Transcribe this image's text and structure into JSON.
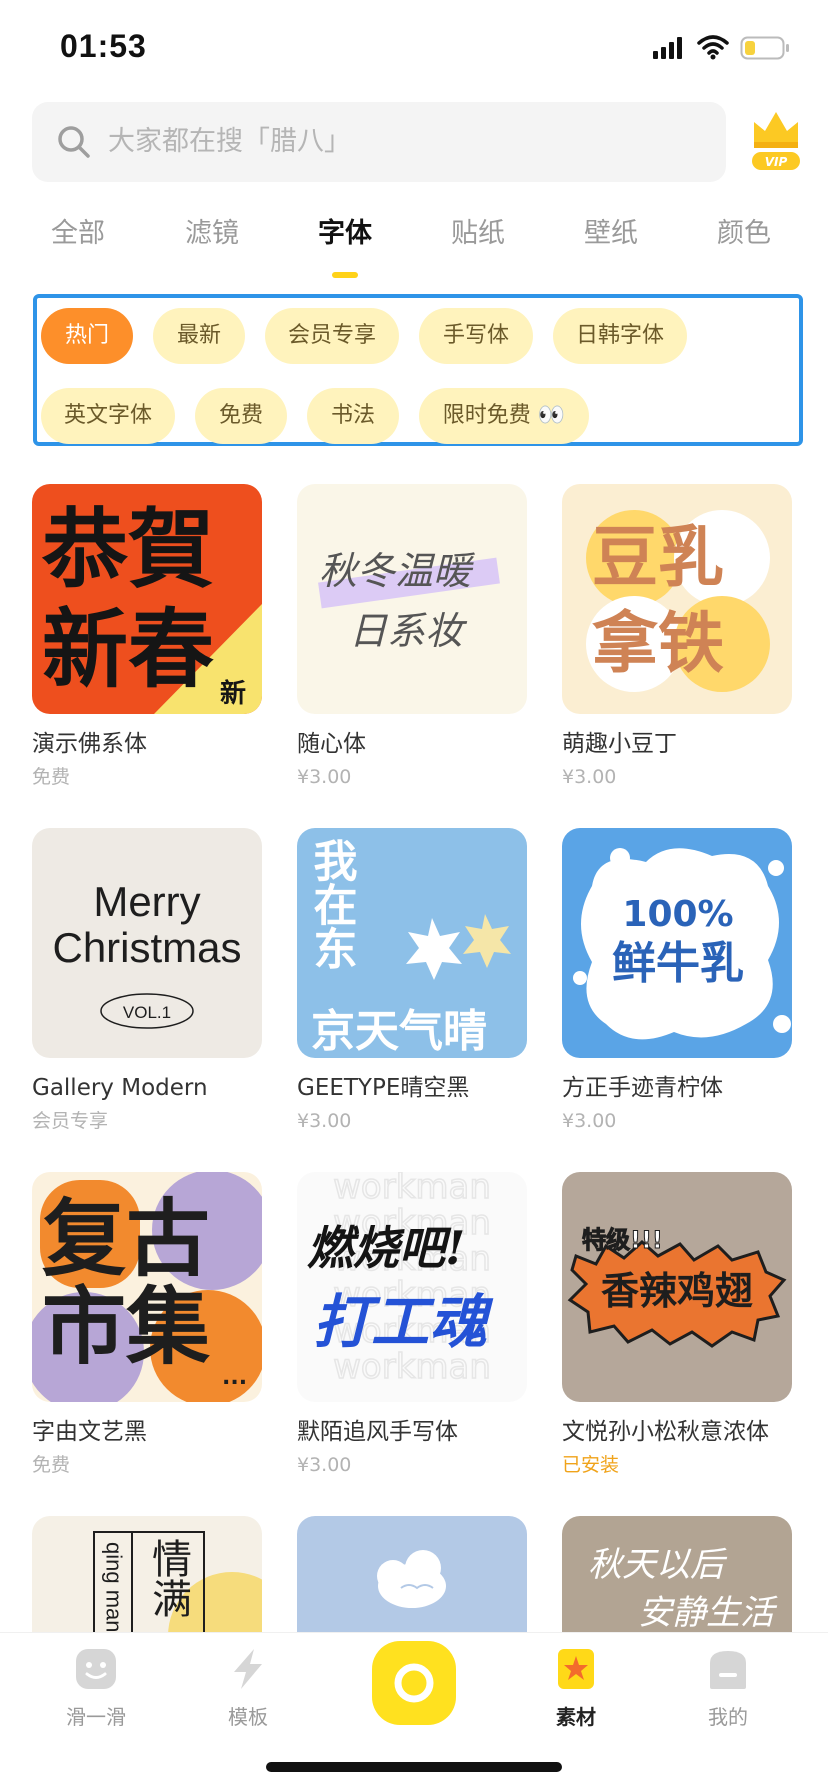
{
  "status_bar": {
    "time": "01:53"
  },
  "search": {
    "placeholder": "大家都在搜「腊八」",
    "vip_label": "VIP"
  },
  "tabs": [
    {
      "label": "全部"
    },
    {
      "label": "滤镜"
    },
    {
      "label": "字体",
      "active": true
    },
    {
      "label": "贴纸"
    },
    {
      "label": "壁纸"
    },
    {
      "label": "颜色"
    }
  ],
  "filters": [
    {
      "label": "热门",
      "active": true
    },
    {
      "label": "最新"
    },
    {
      "label": "会员专享"
    },
    {
      "label": "手写体"
    },
    {
      "label": "日韩字体"
    },
    {
      "label": "英文字体"
    },
    {
      "label": "免费"
    },
    {
      "label": "书法"
    },
    {
      "label": "限时免费 👀"
    }
  ],
  "fonts": [
    {
      "name": "演示佛系体",
      "price": "免费",
      "art": {
        "line1": "恭賀",
        "line2": "新春",
        "corner": "新"
      }
    },
    {
      "name": "随心体",
      "price": "¥3.00",
      "art": {
        "line1": "秋冬温暖",
        "line2": "日系妆"
      }
    },
    {
      "name": "萌趣小豆丁",
      "price": "¥3.00",
      "art": {
        "line1": "豆乳",
        "line2": "拿铁"
      }
    },
    {
      "name": "Gallery Modern",
      "price": "会员专享",
      "art": {
        "line1": "Merry",
        "line2": "Christmas",
        "vol": "VOL.1"
      }
    },
    {
      "name": "GEETYPE晴空黑",
      "price": "¥3.00",
      "art": {
        "col1": "我在东",
        "line": "京天气晴"
      }
    },
    {
      "name": "方正手迹青柠体",
      "price": "¥3.00",
      "art": {
        "line1": "100%",
        "line2": "鲜牛乳"
      }
    },
    {
      "name": "字由文艺黑",
      "price": "免费",
      "art": {
        "line1": "复古",
        "line2": "市集",
        "dots": "..."
      }
    },
    {
      "name": "默陌追风手写体",
      "price": "¥3.00",
      "art": {
        "bg_word": "workman",
        "line1": "燃烧吧!",
        "line2": "打工魂"
      }
    },
    {
      "name": "文悦孙小松秋意浓体",
      "price": "已安装",
      "art": {
        "tag": "特级!!!",
        "line": "香辣鸡翅"
      }
    },
    {
      "art": {
        "latin": "qing man",
        "line": "情满"
      }
    },
    {
      "art": {}
    },
    {
      "art": {
        "line1": "秋天以后",
        "line2": "安静生活"
      }
    }
  ],
  "bottom_nav": [
    {
      "label": "滑一滑"
    },
    {
      "label": "模板"
    },
    {
      "label": "素材",
      "active": true
    },
    {
      "label": "我的"
    }
  ],
  "colors": {
    "accent_yellow": "#ffe11f",
    "active_chip": "#fd8f2a",
    "chip_bg": "#fff3bd",
    "selection_border": "#2e94e8",
    "installed_text": "#f0a31a"
  }
}
